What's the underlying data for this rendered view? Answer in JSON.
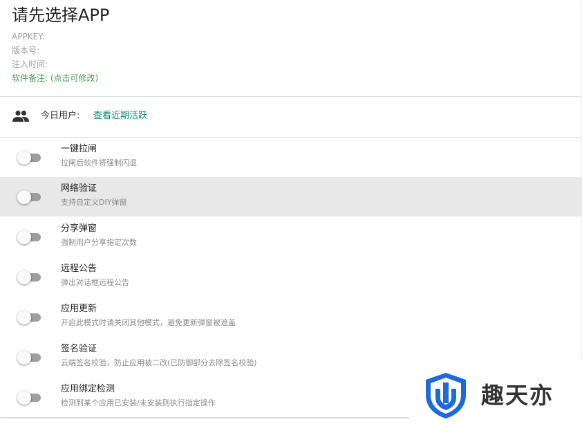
{
  "header": {
    "title": "请先选择APP",
    "appkey_label": "APPKEY:",
    "version_label": "版本号:",
    "inject_time_label": "注入时间:",
    "remark_label": "软件备注: (点击可修改)"
  },
  "users": {
    "icon": "group-icon",
    "label": "今日用户:",
    "link": "查看近期活跃"
  },
  "toggles": [
    {
      "title": "一键拉闸",
      "subtitle": "拉闸后软件将强制闪退",
      "checked": false
    },
    {
      "title": "网络验证",
      "subtitle": "支持自定义DIY弹窗",
      "checked": false
    },
    {
      "title": "分享弹窗",
      "subtitle": "强制用户分享指定次数",
      "checked": false
    },
    {
      "title": "远程公告",
      "subtitle": "弹出对话框远程公告",
      "checked": false
    },
    {
      "title": "应用更新",
      "subtitle": "开启此模式时请关闭其他模式，避免更新弹窗被遮盖",
      "checked": false
    },
    {
      "title": "签名验证",
      "subtitle": "云端签名校验，防止应用被二改(已防御部分去除签名校验)",
      "checked": false
    },
    {
      "title": "应用绑定检测",
      "subtitle": "检测到某个应用已安装/未安装则执行指定操作",
      "checked": false
    }
  ],
  "watermark": {
    "text": "趣天亦",
    "logo": "shield-logo"
  },
  "colors": {
    "accent": "#00897b",
    "green": "#43a047",
    "shield": "#1e6ad8"
  }
}
